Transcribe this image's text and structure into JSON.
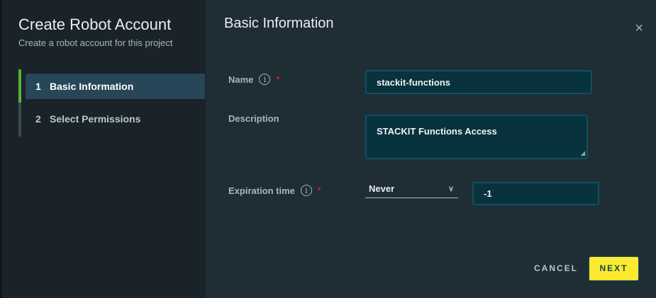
{
  "sidebar": {
    "title": "Create Robot Account",
    "subtitle": "Create a robot account for this project",
    "steps": [
      {
        "number": "1",
        "label": "Basic Information",
        "active": true
      },
      {
        "number": "2",
        "label": "Select Permissions",
        "active": false
      }
    ]
  },
  "main": {
    "heading": "Basic Information",
    "close_icon": "×",
    "name": {
      "label": "Name",
      "required": "*",
      "value": "stackit-functions"
    },
    "description": {
      "label": "Description",
      "value": "STACKIT Functions Access"
    },
    "expiration": {
      "label": "Expiration time",
      "required": "*",
      "selected": "Never",
      "value": "-1"
    },
    "cancel_label": "CANCEL",
    "next_label": "NEXT"
  },
  "colors": {
    "accent": "#fde92f",
    "active_step": "#274657",
    "step_indicator": "#5ab031"
  }
}
